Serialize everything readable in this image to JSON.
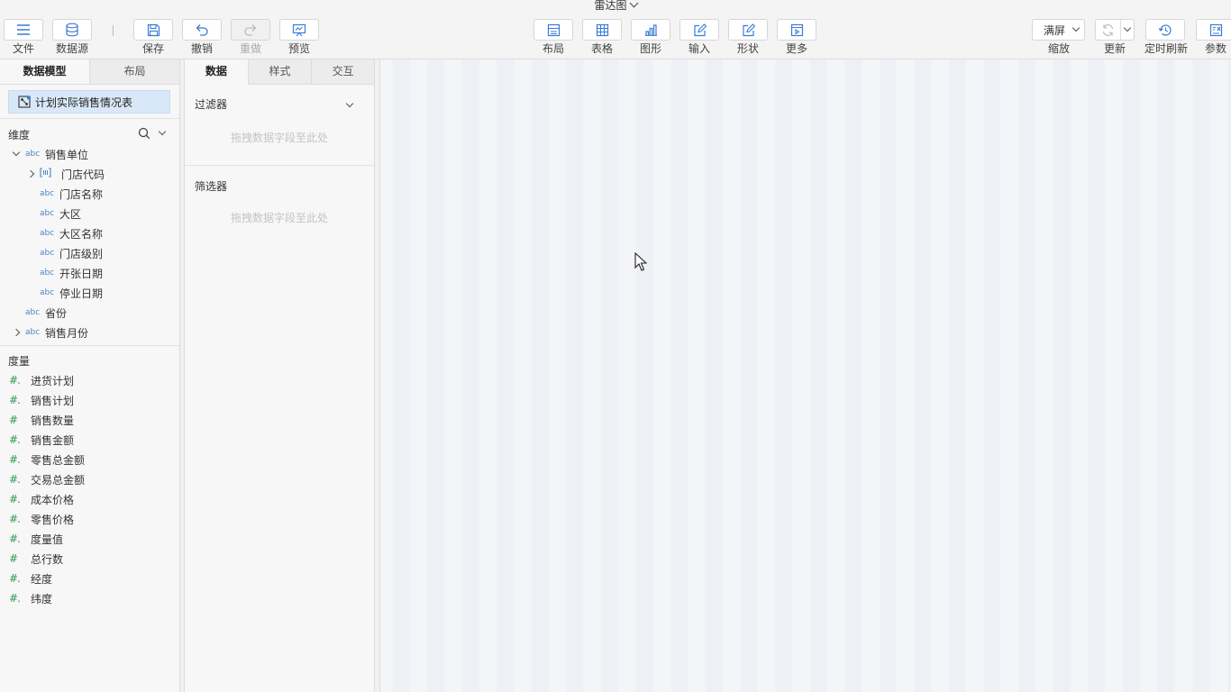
{
  "document": {
    "title": "雷达图"
  },
  "toolbar": {
    "file": "文件",
    "datasource": "数据源",
    "save": "保存",
    "undo": "撤销",
    "redo": "重做",
    "preview": "预览",
    "layout": "布局",
    "table": "表格",
    "chart": "图形",
    "input": "输入",
    "shape": "形状",
    "more": "更多",
    "zoom_value": "满屏",
    "zoom_label": "缩放",
    "refresh": "更新",
    "timed_refresh": "定时刷新",
    "params": "参数"
  },
  "left_panel": {
    "tabs": [
      "数据模型",
      "布局"
    ],
    "model_name": "计划实际销售情况表",
    "dimension_header": "维度",
    "dimensions": [
      {
        "label": "销售单位",
        "type": "abc"
      },
      {
        "label": "门店代码",
        "type": "key"
      },
      {
        "label": "门店名称",
        "type": "abc"
      },
      {
        "label": "大区",
        "type": "abc"
      },
      {
        "label": "大区名称",
        "type": "abc"
      },
      {
        "label": "门店级别",
        "type": "abc"
      },
      {
        "label": "开张日期",
        "type": "abc"
      },
      {
        "label": "停业日期",
        "type": "abc"
      },
      {
        "label": "省份",
        "type": "abc"
      },
      {
        "label": "销售月份",
        "type": "abc"
      }
    ],
    "abc_tag": "abc",
    "measure_header": "度量",
    "measures": [
      {
        "label": "进货计划",
        "tag": "#."
      },
      {
        "label": "销售计划",
        "tag": "#."
      },
      {
        "label": "销售数量",
        "tag": "#"
      },
      {
        "label": "销售金额",
        "tag": "#."
      },
      {
        "label": "零售总金额",
        "tag": "#."
      },
      {
        "label": "交易总金额",
        "tag": "#."
      },
      {
        "label": "成本价格",
        "tag": "#."
      },
      {
        "label": "零售价格",
        "tag": "#."
      },
      {
        "label": "度量值",
        "tag": "#."
      },
      {
        "label": "总行数",
        "tag": "#"
      },
      {
        "label": "经度",
        "tag": "#."
      },
      {
        "label": "纬度",
        "tag": "#."
      }
    ]
  },
  "mid_panel": {
    "tabs": [
      "数据",
      "样式",
      "交互"
    ],
    "filter_title": "过滤器",
    "filter_placeholder": "拖拽数据字段至此处",
    "selector_title": "筛选器",
    "selector_placeholder": "拖拽数据字段至此处"
  },
  "colors": {
    "accent": "#3a7bd5",
    "selected_bg": "#d9e8f8",
    "measure_green": "#2e9a55",
    "canvas_bg": "#f4f5f9"
  }
}
